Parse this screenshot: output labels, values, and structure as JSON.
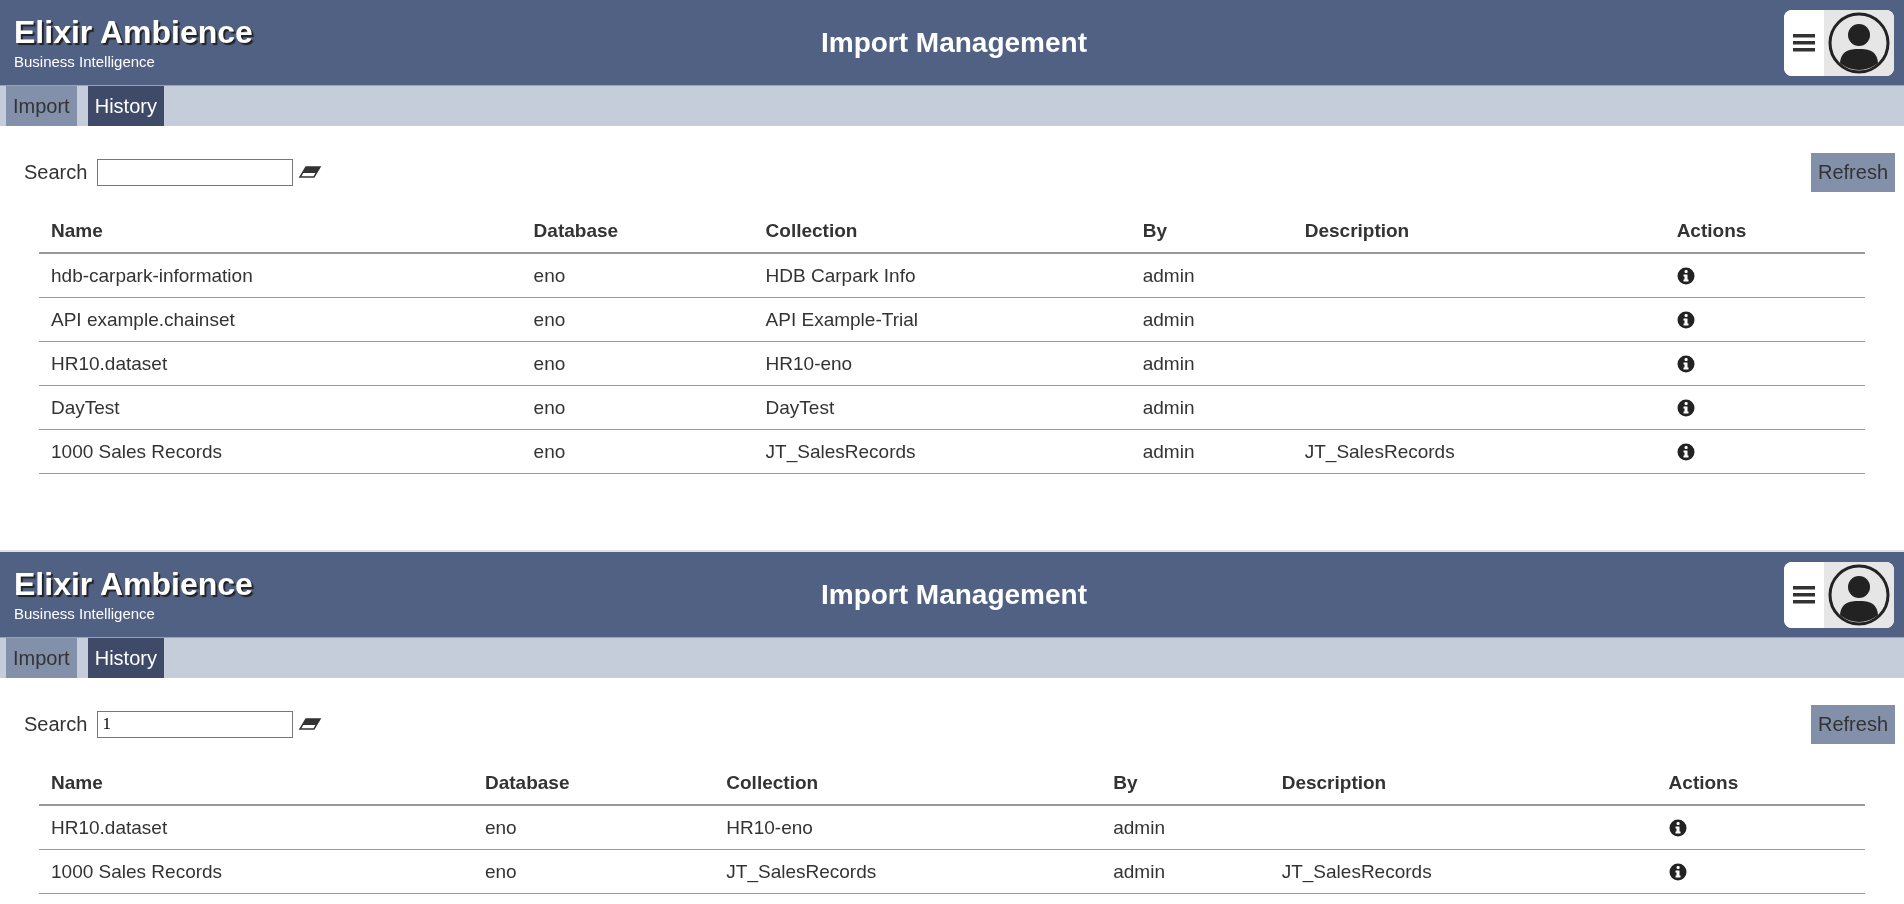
{
  "panels": [
    {
      "brand": {
        "title": "Elixir Ambience",
        "subtitle": "Business Intelligence"
      },
      "page_title": "Import Management",
      "tabs": [
        {
          "label": "Import",
          "selected": false
        },
        {
          "label": "History",
          "selected": true
        }
      ],
      "search": {
        "label": "Search"
      },
      "refresh": "Refresh",
      "table": {
        "columns": [
          "Name",
          "Database",
          "Collection",
          "By",
          "Description",
          "Actions"
        ],
        "rows": [
          [
            "hdb-carpark-information",
            "eno",
            "HDB Carpark Info",
            "admin",
            ""
          ],
          [
            "API example.chainset",
            "eno",
            "API Example-Trial",
            "admin",
            ""
          ],
          [
            "HR10.dataset",
            "eno",
            "HR10-eno",
            "admin",
            ""
          ],
          [
            "DayTest",
            "eno",
            "DayTest",
            "admin",
            ""
          ],
          [
            "1000 Sales Records",
            "eno",
            "JT_SalesRecords",
            "admin",
            "JT_SalesRecords"
          ]
        ]
      }
    },
    {
      "brand": {
        "title": "Elixir Ambience",
        "subtitle": "Business Intelligence"
      },
      "page_title": "Import Management",
      "tabs": [
        {
          "label": "Import",
          "selected": false
        },
        {
          "label": "History",
          "selected": true
        }
      ],
      "search": {
        "label": "Search",
        "value": "1"
      },
      "refresh": "Refresh",
      "table": {
        "columns": [
          "Name",
          "Database",
          "Collection",
          "By",
          "Description",
          "Actions"
        ],
        "rows": [
          [
            "HR10.dataset",
            "eno",
            "HR10-eno",
            "admin",
            ""
          ],
          [
            "1000 Sales Records",
            "eno",
            "JT_SalesRecords",
            "admin",
            "JT_SalesRecords"
          ]
        ]
      }
    }
  ]
}
